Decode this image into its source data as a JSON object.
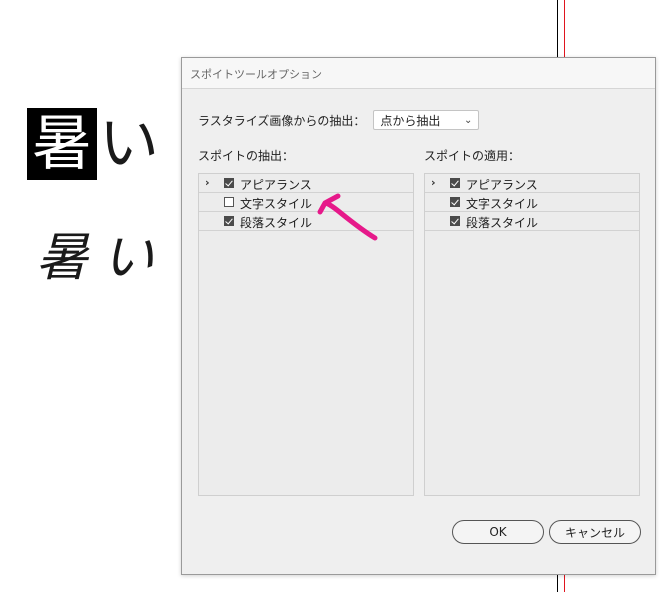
{
  "canvas": {
    "sample_top_highlight": "暑",
    "sample_top_rest": "い",
    "sample_bottom": "暑い",
    "guide_colors": {
      "line1": "#000000",
      "line2": "#e0141e"
    }
  },
  "dialog": {
    "title": "スポイトツールオプション",
    "raster_label": "ラスタライズ画像からの抽出：",
    "raster_select_value": "点から抽出",
    "left_panel": {
      "heading": "スポイトの抽出：",
      "items": [
        {
          "label": "アピアランス",
          "checked": true,
          "expandable": true
        },
        {
          "label": "文字スタイル",
          "checked": false,
          "expandable": false
        },
        {
          "label": "段落スタイル",
          "checked": true,
          "expandable": false
        }
      ]
    },
    "right_panel": {
      "heading": "スポイトの適用：",
      "items": [
        {
          "label": "アピアランス",
          "checked": true,
          "expandable": true
        },
        {
          "label": "文字スタイル",
          "checked": true,
          "expandable": false
        },
        {
          "label": "段落スタイル",
          "checked": true,
          "expandable": false
        }
      ]
    },
    "ok_label": "OK",
    "cancel_label": "キャンセル"
  },
  "annotation": {
    "type": "arrow",
    "color": "#e6198a",
    "points_to": "文字スタイル"
  }
}
